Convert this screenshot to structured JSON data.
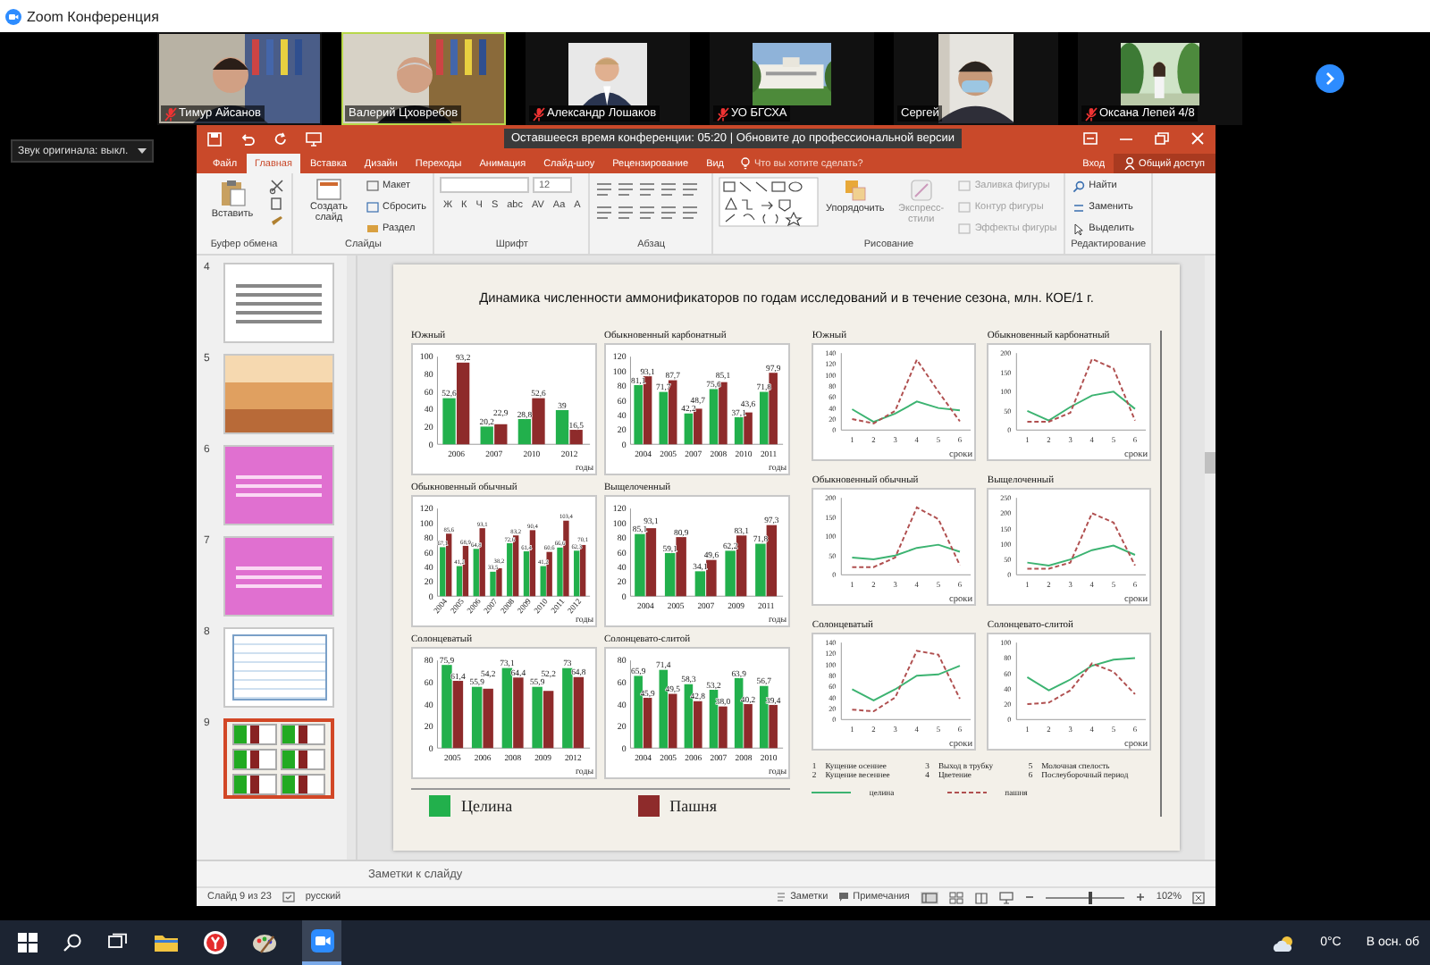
{
  "window": {
    "title": "Zoom Конференция"
  },
  "participants": [
    {
      "name": "Тимур Айсанов",
      "muted": true,
      "speaking": false,
      "kind": "camera"
    },
    {
      "name": "Валерий Цховребов",
      "muted": false,
      "speaking": true,
      "kind": "camera"
    },
    {
      "name": "Александр Лошаков",
      "muted": true,
      "speaking": false
    },
    {
      "name": "УО БГСХА",
      "muted": true,
      "speaking": false
    },
    {
      "name": "Сергей",
      "muted": false,
      "speaking": false,
      "kind": "portrait"
    },
    {
      "name": "Оксана Лепей 4/8",
      "muted": true,
      "speaking": false
    }
  ],
  "audio_menu": {
    "label": "Звук оригинала: выкл."
  },
  "timer_banner": "Оставшееся время конференции: 05:20 | Обновите до профессиональной версии",
  "ribbon_tabs": [
    {
      "label": "Файл",
      "selected": false
    },
    {
      "label": "Главная",
      "selected": true
    },
    {
      "label": "Вставка",
      "selected": false
    },
    {
      "label": "Дизайн",
      "selected": false
    },
    {
      "label": "Переходы",
      "selected": false
    },
    {
      "label": "Анимация",
      "selected": false
    },
    {
      "label": "Слайд-шоу",
      "selected": false
    },
    {
      "label": "Рецензирование",
      "selected": false
    },
    {
      "label": "Вид",
      "selected": false
    }
  ],
  "tell_me": "Что вы хотите сделать?",
  "sign_in": "Вход",
  "share": "Общий доступ",
  "ribbon": {
    "clipboard": {
      "paste": "Вставить",
      "label": "Буфер обмена"
    },
    "slides": {
      "new_slide": "Создать слайд",
      "layout": "Макет",
      "reset": "Сбросить",
      "section": "Раздел",
      "label": "Слайды"
    },
    "font": {
      "size": "12",
      "format_buttons": [
        "Ж",
        "К",
        "Ч",
        "S",
        "abc",
        "AV",
        "Aa",
        "A"
      ],
      "label": "Шрифт"
    },
    "paragraph": {
      "label": "Абзац"
    },
    "drawing": {
      "arrange": "Упорядочить",
      "quick_styles": "Экспресс-стили",
      "shape_format": [
        {
          "label": "Заливка фигуры",
          "disabled": true
        },
        {
          "label": "Контур фигуры",
          "disabled": true
        },
        {
          "label": "Эффекты фигуры",
          "disabled": true
        }
      ],
      "label": "Рисование"
    },
    "editing": {
      "find": "Найти",
      "replace": "Заменить",
      "select": "Выделить",
      "label": "Редактирование"
    }
  },
  "slides": [
    {
      "number": "4",
      "selected": false,
      "kind": "text"
    },
    {
      "number": "5",
      "selected": false
    },
    {
      "number": "6",
      "selected": false,
      "kind": "pink"
    },
    {
      "number": "7",
      "selected": false,
      "kind": "pink"
    },
    {
      "number": "8",
      "selected": false,
      "kind": "table"
    },
    {
      "number": "9",
      "selected": true,
      "kind": "charts"
    }
  ],
  "slide": {
    "title": "Динамика численности аммонификаторов по годам исследований и в течение сезона, млн. КОЕ/1 г.",
    "bar_charts": [
      {
        "chart_data": {
          "type": "bar",
          "title": "Южный",
          "categories": [
            "2006",
            "2007",
            "2010",
            "2012"
          ],
          "xlabel": "годы",
          "ylim": [
            0,
            100
          ],
          "yticks": [
            0,
            20,
            40,
            60,
            80,
            100
          ],
          "series": [
            {
              "color": "#22b04c",
              "values": [
                52.6,
                20.2,
                28.8,
                39
              ],
              "value_labels": [
                "52,6",
                "20,2",
                "28,8",
                "39"
              ]
            },
            {
              "color": "#8e2b2b",
              "values": [
                93.2,
                22.9,
                52.6,
                16.5
              ],
              "value_labels": [
                "93,2",
                "22,9",
                "52,6",
                "16,5"
              ]
            }
          ]
        }
      },
      {
        "chart_data": {
          "type": "bar",
          "title": "Обыкновенный карбонатный",
          "categories": [
            "2004",
            "2005",
            "2007",
            "2008",
            "2010",
            "2011"
          ],
          "xlabel": "годы",
          "ylim": [
            0,
            120
          ],
          "yticks": [
            0,
            20,
            40,
            60,
            80,
            100,
            120
          ],
          "series": [
            {
              "color": "#22b04c",
              "values": [
                81.1,
                71.7,
                42.2,
                75.6,
                37.1,
                71.8
              ],
              "value_labels": [
                "81,1",
                "71,7",
                "42,2",
                "75,6",
                "37,1",
                "71,8"
              ]
            },
            {
              "color": "#8e2b2b",
              "values": [
                93.1,
                87.7,
                48.7,
                85.1,
                43.6,
                97.9
              ],
              "value_labels": [
                "93,1",
                "87,7",
                "48,7",
                "85,1",
                "43,6",
                "97,9"
              ]
            }
          ]
        }
      },
      {
        "chart_data": {
          "type": "bar",
          "title": "Обыкновенный обычный",
          "categories": [
            "2004",
            "2005",
            "2006",
            "2007",
            "2008",
            "2009",
            "2010",
            "2011",
            "2012"
          ],
          "xlabel": "годы",
          "ylim": [
            0,
            120
          ],
          "yticks": [
            0,
            20,
            40,
            60,
            80,
            100,
            120
          ],
          "series": [
            {
              "color": "#22b04c",
              "values": [
                67.1,
                41.2,
                64.8,
                33.5,
                72.6,
                61.4,
                41.2,
                66.6,
                62.3
              ],
              "value_labels": [
                "67,1",
                "41,2",
                "64,8",
                "33,5",
                "72,6",
                "61,4",
                "41,2",
                "66,6",
                "62,3"
              ]
            },
            {
              "color": "#8e2b2b",
              "values": [
                85.6,
                68.9,
                93.1,
                38.2,
                83.2,
                90.4,
                60.6,
                103.4,
                70.1
              ],
              "value_labels": [
                "85,6",
                "68,9",
                "93,1",
                "38,2",
                "83,2",
                "90,4",
                "60,6",
                "103,4",
                "70,1"
              ]
            }
          ]
        }
      },
      {
        "chart_data": {
          "type": "bar",
          "title": "Выщелоченный",
          "categories": [
            "2004",
            "2005",
            "2007",
            "2009",
            "2011"
          ],
          "xlabel": "годы",
          "ylim": [
            0,
            120
          ],
          "yticks": [
            0,
            20,
            40,
            60,
            80,
            100,
            120
          ],
          "series": [
            {
              "color": "#22b04c",
              "values": [
                85.1,
                59.1,
                34.1,
                62.2,
                71.8
              ],
              "value_labels": [
                "85,1",
                "59,1",
                "34,1",
                "62,2",
                "71,8"
              ]
            },
            {
              "color": "#8e2b2b",
              "values": [
                93.1,
                80.9,
                49.6,
                83.1,
                97.3
              ],
              "value_labels": [
                "93,1",
                "80,9",
                "49,6",
                "83,1",
                "97,3"
              ]
            }
          ]
        }
      },
      {
        "chart_data": {
          "type": "bar",
          "title": "Солонцеватый",
          "categories": [
            "2005",
            "2006",
            "2008",
            "2009",
            "2012"
          ],
          "xlabel": "годы",
          "ylim": [
            0,
            80
          ],
          "yticks": [
            0,
            20,
            40,
            60,
            80
          ],
          "series": [
            {
              "color": "#22b04c",
              "values": [
                75.9,
                55.9,
                73.1,
                55.9,
                73
              ],
              "value_labels": [
                "75,9",
                "55,9",
                "73,1",
                "55,9",
                "73"
              ]
            },
            {
              "color": "#8e2b2b",
              "values": [
                61.4,
                54.2,
                64.4,
                52.2,
                64.8
              ],
              "value_labels": [
                "61,4",
                "54,2",
                "64,4",
                "52,2",
                "64,8"
              ]
            }
          ]
        }
      },
      {
        "chart_data": {
          "type": "bar",
          "title": "Солонцевато-слитой",
          "categories": [
            "2004",
            "2005",
            "2006",
            "2007",
            "2008",
            "2010"
          ],
          "xlabel": "годы",
          "ylim": [
            0,
            80
          ],
          "yticks": [
            0,
            20,
            40,
            60,
            80
          ],
          "series": [
            {
              "color": "#22b04c",
              "values": [
                65.9,
                71.4,
                58.3,
                53.2,
                63.9,
                56.7
              ],
              "value_labels": [
                "65,9",
                "71,4",
                "58,3",
                "53,2",
                "63,9",
                "56,7"
              ]
            },
            {
              "color": "#8e2b2b",
              "values": [
                45.9,
                49.5,
                42.8,
                38.0,
                40.2,
                39.4
              ],
              "value_labels": [
                "45,9",
                "49,5",
                "42,8",
                "38,0",
                "40,2",
                "39,4"
              ]
            }
          ]
        }
      }
    ],
    "bar_legend": [
      {
        "label": "Целина",
        "color": "#22b04c"
      },
      {
        "label": "Пашня",
        "color": "#8e2b2b"
      }
    ],
    "line_charts": [
      {
        "chart_data": {
          "type": "line",
          "title": "Южный",
          "x": [
            1,
            2,
            3,
            4,
            5,
            6
          ],
          "xlabel": "сроки",
          "ylim": [
            0,
            140
          ],
          "yticks": [
            0,
            20,
            40,
            60,
            80,
            100,
            120,
            140
          ],
          "series": [
            {
              "color": "#3cb371",
              "line_style": "solid",
              "values": [
                38,
                15,
                30,
                52,
                40,
                36
              ]
            },
            {
              "color": "#b05050",
              "line_style": "dashed",
              "values": [
                20,
                12,
                35,
                128,
                70,
                16
              ]
            }
          ]
        }
      },
      {
        "chart_data": {
          "type": "line",
          "title": "Обыкновенный карбонатный",
          "x": [
            1,
            2,
            3,
            4,
            5,
            6
          ],
          "xlabel": "сроки",
          "ylim": [
            0,
            200
          ],
          "yticks": [
            0,
            50,
            100,
            150,
            200
          ],
          "series": [
            {
              "color": "#3cb371",
              "line_style": "solid",
              "values": [
                50,
                25,
                60,
                90,
                100,
                55
              ]
            },
            {
              "color": "#b05050",
              "line_style": "dashed",
              "values": [
                22,
                22,
                45,
                185,
                160,
                25
              ]
            }
          ]
        }
      },
      {
        "chart_data": {
          "type": "line",
          "title": "Обыкновенный обычный",
          "x": [
            1,
            2,
            3,
            4,
            5,
            6
          ],
          "xlabel": "сроки",
          "ylim": [
            0,
            200
          ],
          "yticks": [
            0,
            50,
            100,
            150,
            200
          ],
          "series": [
            {
              "color": "#3cb371",
              "line_style": "solid",
              "values": [
                45,
                40,
                50,
                70,
                78,
                60
              ]
            },
            {
              "color": "#b05050",
              "line_style": "dashed",
              "values": [
                20,
                20,
                45,
                175,
                145,
                25
              ]
            }
          ]
        }
      },
      {
        "chart_data": {
          "type": "line",
          "title": "Выщелоченный",
          "x": [
            1,
            2,
            3,
            4,
            5,
            6
          ],
          "xlabel": "сроки",
          "ylim": [
            0,
            250
          ],
          "yticks": [
            0,
            50,
            100,
            150,
            200,
            250
          ],
          "series": [
            {
              "color": "#3cb371",
              "line_style": "solid",
              "values": [
                40,
                30,
                50,
                80,
                95,
                65
              ]
            },
            {
              "color": "#b05050",
              "line_style": "dashed",
              "values": [
                20,
                20,
                40,
                200,
                170,
                30
              ]
            }
          ]
        }
      },
      {
        "chart_data": {
          "type": "line",
          "title": "Солонцеватый",
          "x": [
            1,
            2,
            3,
            4,
            5,
            6
          ],
          "xlabel": "сроки",
          "ylim": [
            0,
            140
          ],
          "yticks": [
            0,
            20,
            40,
            60,
            80,
            100,
            120,
            140
          ],
          "series": [
            {
              "color": "#3cb371",
              "line_style": "solid",
              "values": [
                55,
                35,
                55,
                80,
                82,
                98
              ]
            },
            {
              "color": "#b05050",
              "line_style": "dashed",
              "values": [
                18,
                15,
                40,
                125,
                118,
                38
              ]
            }
          ]
        }
      },
      {
        "chart_data": {
          "type": "line",
          "title": "Солонцевато-слитой",
          "x": [
            1,
            2,
            3,
            4,
            5,
            6
          ],
          "xlabel": "сроки",
          "ylim": [
            0,
            100
          ],
          "yticks": [
            0,
            20,
            40,
            60,
            80,
            100
          ],
          "series": [
            {
              "color": "#3cb371",
              "line_style": "solid",
              "values": [
                55,
                38,
                52,
                70,
                78,
                80
              ]
            },
            {
              "color": "#b05050",
              "line_style": "dashed",
              "values": [
                20,
                22,
                38,
                73,
                62,
                33
              ]
            }
          ]
        }
      }
    ],
    "stage_legend": [
      {
        "number": "1",
        "label": "Кущение осеннее"
      },
      {
        "number": "2",
        "label": "Кущение весеннее"
      },
      {
        "number": "3",
        "label": "Выход в трубку"
      },
      {
        "number": "4",
        "label": "Цветение"
      },
      {
        "number": "5",
        "label": "Молочная спелость"
      },
      {
        "number": "6",
        "label": "Послеуборочный период"
      }
    ],
    "line_legend": [
      {
        "label": "целина",
        "kind": "solid",
        "color": "#3cb371"
      },
      {
        "label": "пашня",
        "kind": "dashed",
        "color": "#b05050"
      }
    ]
  },
  "notes_placeholder": "Заметки к слайду",
  "status_bar": {
    "slide_counter": "Слайд 9 из 23",
    "language": "русский",
    "notes": "Заметки",
    "comments": "Примечания",
    "zoom": "102%",
    "zoom_level": {
      "level": 0.55
    }
  },
  "taskbar": {
    "temperature": "0°C",
    "weather": "В осн. об"
  }
}
